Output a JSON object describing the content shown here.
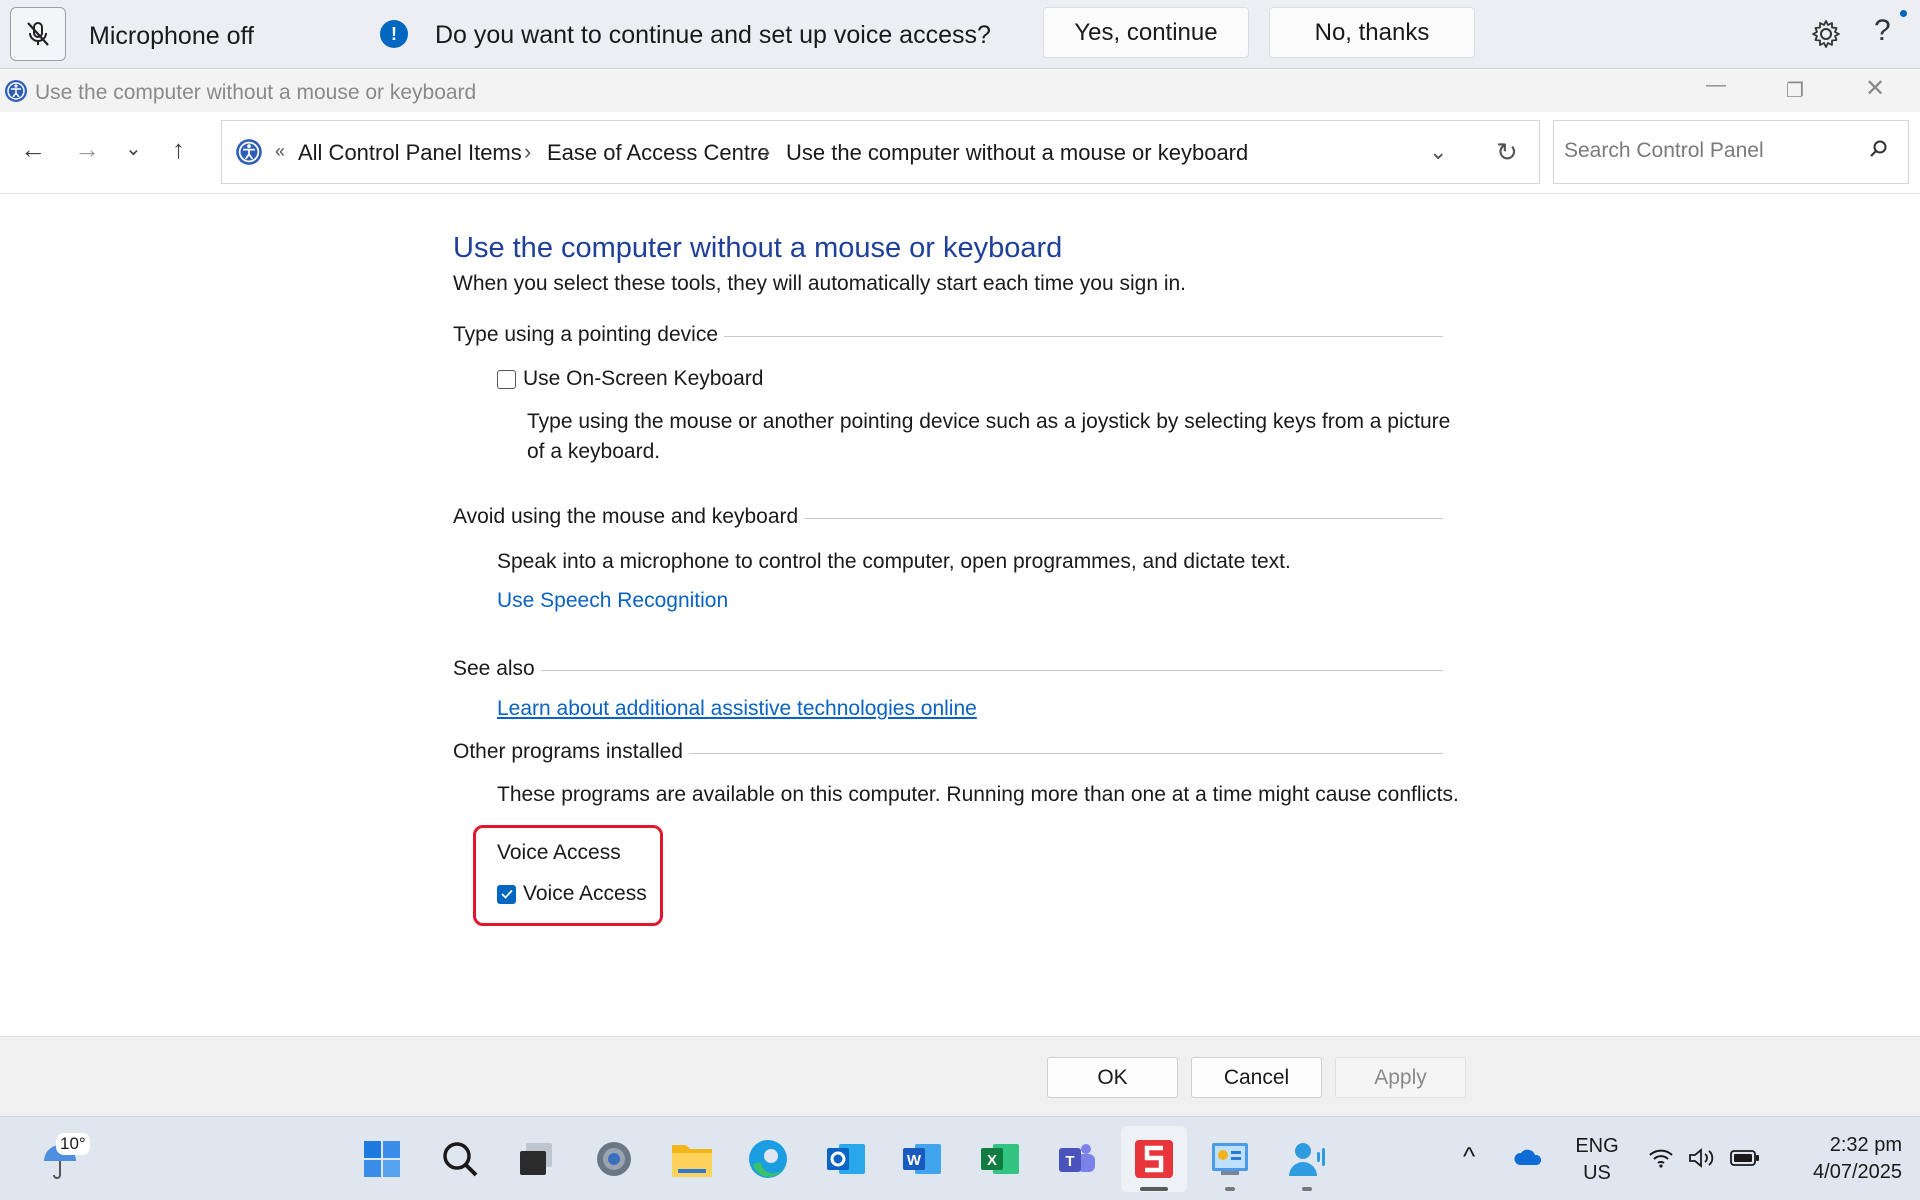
{
  "voice_access_bar": {
    "mic_status": "Microphone off",
    "question": "Do you want to continue and set up voice access?",
    "yes_label": "Yes, continue",
    "no_label": "No, thanks",
    "help_label": "?"
  },
  "window": {
    "title": "Use the computer without a mouse or keyboard",
    "min_label": "—",
    "max_label": "❐",
    "close_label": "✕"
  },
  "nav": {
    "back": "←",
    "forward": "→",
    "recent": "⌄",
    "up": "↑",
    "overflow": "«",
    "breadcrumbs": [
      "All Control Panel Items",
      "Ease of Access Centre",
      "Use the computer without a mouse or keyboard"
    ],
    "sep": "›",
    "dropdown": "⌄",
    "refresh": "↻",
    "search_placeholder": "Search Control Panel"
  },
  "content": {
    "title": "Use the computer without a mouse or keyboard",
    "subtitle": "When you select these tools, they will automatically start each time you sign in.",
    "sections": {
      "pointing": {
        "heading": "Type using a pointing device",
        "checkbox_label": "Use On-Screen Keyboard",
        "checked": false,
        "description": "Type using the mouse or another pointing device such as a joystick by selecting keys from a picture of a keyboard."
      },
      "avoid": {
        "heading": "Avoid using the mouse and keyboard",
        "description": "Speak into a microphone to control the computer, open programmes, and dictate text.",
        "link": "Use Speech Recognition"
      },
      "see_also": {
        "heading": "See also",
        "link": "Learn about additional assistive technologies online"
      },
      "other": {
        "heading": "Other programs installed",
        "description": "These programs are available on this computer. Running more than one at a time might cause conflicts.",
        "group_label": "Voice Access",
        "checkbox_label": "Voice Access",
        "checked": true
      }
    }
  },
  "buttons": {
    "ok": "OK",
    "cancel": "Cancel",
    "apply": "Apply"
  },
  "taskbar": {
    "weather_temp": "10°",
    "apps": [
      "start-icon",
      "search-icon",
      "task-view-icon",
      "settings-icon",
      "file-explorer-icon",
      "edge-icon",
      "outlook-icon",
      "word-icon",
      "excel-icon",
      "teams-icon",
      "snagit-icon",
      "control-panel-icon",
      "voice-access-icon"
    ],
    "tray": {
      "chevron": "^",
      "lang_line1": "ENG",
      "lang_line2": "US",
      "time": "2:32 pm",
      "date": "4/07/2025"
    }
  },
  "colors": {
    "accent": "#0067c0",
    "title_blue": "#1e3f9a",
    "link_blue": "#0a63c4",
    "highlight_red": "#e0162b"
  }
}
